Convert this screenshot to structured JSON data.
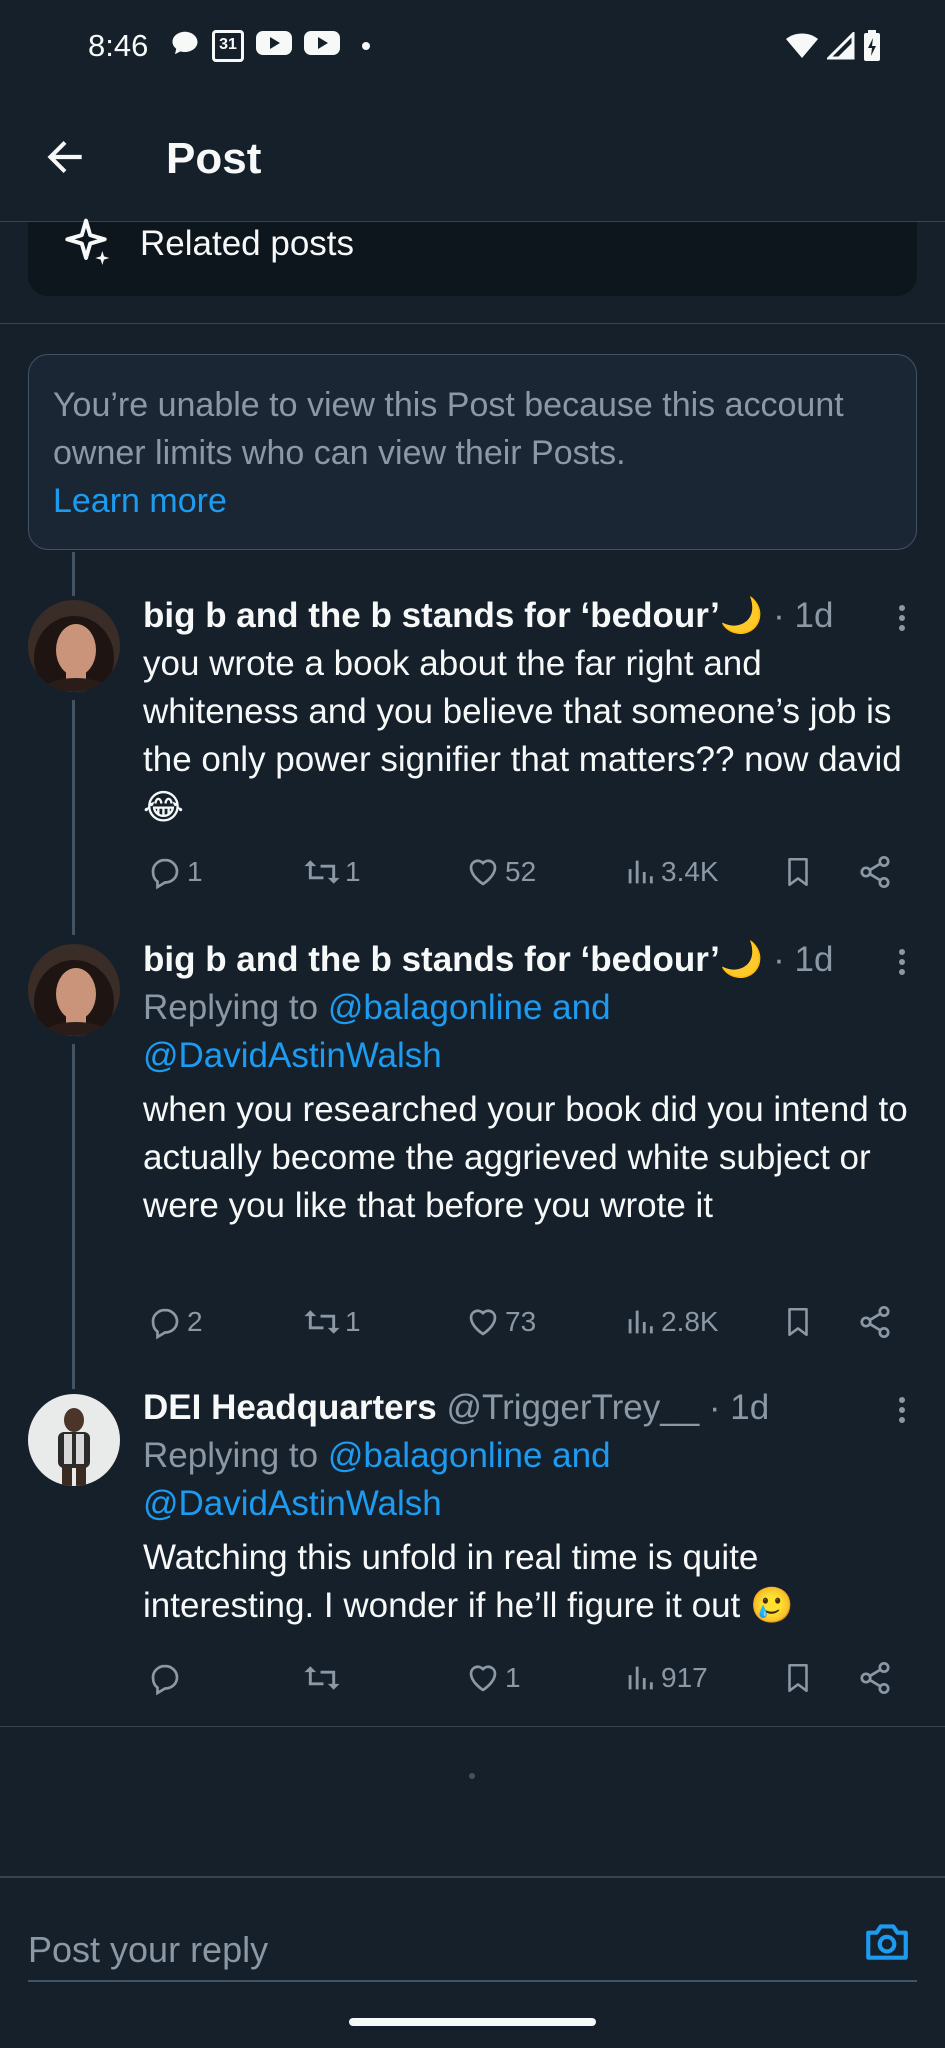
{
  "status_bar": {
    "time": "8:46",
    "calendar_day": "31",
    "left_icons": [
      "chat-bubble-icon",
      "calendar-icon",
      "youtube-icon",
      "youtube-icon",
      "dot-icon"
    ],
    "right_icons": [
      "wifi-icon",
      "cell-signal-icon",
      "battery-icon"
    ]
  },
  "header": {
    "title": "Post",
    "back_icon": "arrow-left-icon"
  },
  "related": {
    "label": "Related posts",
    "icon": "sparkle-icon"
  },
  "notice": {
    "text": "You’re unable to view this Post because this account owner limits who can view their Posts.",
    "link": "Learn more"
  },
  "tweets": [
    {
      "name": "big b and the b stands for ‘bedour’🌙",
      "handle": "",
      "time": "· 1d",
      "replying": null,
      "text": "you wrote a book about the far right and whiteness and you believe that someone’s job is the only power signifier that matters?? now david 😂",
      "replies": "1",
      "reposts": "1",
      "likes": "52",
      "views": "3.4K"
    },
    {
      "name": "big b and the b stands for ‘bedour’🌙",
      "handle": "",
      "time": "· 1d",
      "replying": {
        "prefix": "Replying to ",
        "mentions": "@balagonline and @DavidAstinWalsh"
      },
      "text": "when you researched your book did you intend to actually become the aggrieved white subject or were you like that before you wrote it",
      "replies": "2",
      "reposts": "1",
      "likes": "73",
      "views": "2.8K"
    },
    {
      "name": "DEI Headquarters",
      "handle": "@TriggerTrey__",
      "time": "· 1d",
      "replying": {
        "prefix": "Replying to ",
        "mentions": "@balagonline and @DavidAstinWalsh"
      },
      "text": "Watching this unfold in real time is quite interesting. I wonder if he’ll figure it out 🥲",
      "replies": "",
      "reposts": "",
      "likes": "1",
      "views": "917"
    }
  ],
  "reply_bar": {
    "placeholder": "Post your reply",
    "camera_icon": "camera-icon"
  },
  "colors": {
    "background": "#15202b",
    "accent": "#1d9bf0",
    "muted": "#8b98a5",
    "divider": "#38444d"
  }
}
